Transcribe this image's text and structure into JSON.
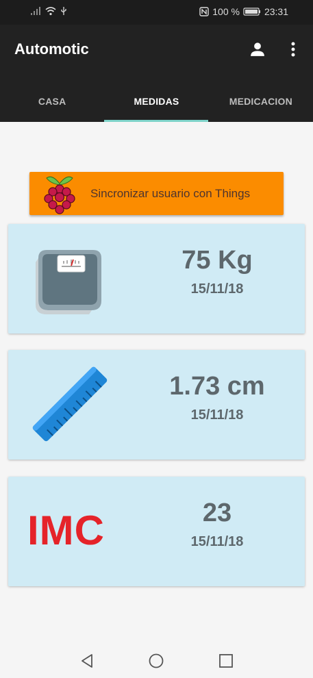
{
  "status_bar": {
    "battery": "100 %",
    "time": "23:31"
  },
  "app_bar": {
    "title": "Automotic",
    "icons": [
      "account-icon",
      "more-vert-icon"
    ]
  },
  "tabs": [
    {
      "label": "CASA",
      "active": false
    },
    {
      "label": "MEDIDAS",
      "active": true
    },
    {
      "label": "MEDICACION",
      "active": false
    }
  ],
  "sync": {
    "label": "Sincronizar usuario con Things",
    "icon": "raspberry-pi-icon"
  },
  "cards": [
    {
      "icon": "scale-icon",
      "value": "75 Kg",
      "date": "15/11/18"
    },
    {
      "icon": "ruler-icon",
      "value": "1.73 cm",
      "date": "15/11/18"
    },
    {
      "icon": "imc-label",
      "label": "IMC",
      "value": "23",
      "date": "15/11/18"
    }
  ],
  "colors": {
    "app_bar": "#222222",
    "tab_indicator": "#7fd3c9",
    "sync_button": "#fb8c00",
    "card_background": "#d0ebf5",
    "value_text": "#5d676c",
    "imc_red": "#e52329"
  },
  "nav_bar": [
    "back-icon",
    "home-icon",
    "recents-icon"
  ]
}
